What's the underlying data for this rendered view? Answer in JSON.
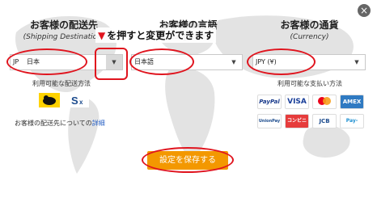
{
  "dialog": {
    "close_label": "×"
  },
  "shipping": {
    "title": "お客様の配送先",
    "title_en": "(Shipping Destination)",
    "country_code": "JP",
    "country_name": "日本",
    "methods_label": "利用可能な配送方法",
    "note_prefix": "お客様の配送先についての",
    "note_link": "詳細"
  },
  "language": {
    "title": "お客様の言語",
    "title_en": "(Language)",
    "value": "日本語"
  },
  "currency": {
    "title": "お客様の通貨",
    "title_en": "(Currency)",
    "value": "JPY (¥)",
    "payment_label": "利用可能な支払い方法"
  },
  "annotation": {
    "marker": "▼",
    "text": "を押すと変更ができます"
  },
  "carriers": [
    "yamato-logo",
    "sagawa-logo"
  ],
  "payments": {
    "paypal": "PayPal",
    "visa": "VISA",
    "mastercard": "mastercard",
    "amex": "AMEX",
    "unionpay": "UnionPay",
    "conveni": "コンビニ",
    "jcb": "JCB",
    "payeasy": "Pay-easy"
  },
  "save_button": "設定を保存する",
  "colors": {
    "accent": "#f39800",
    "annotation": "#e0141e",
    "link": "#2a62c5"
  }
}
